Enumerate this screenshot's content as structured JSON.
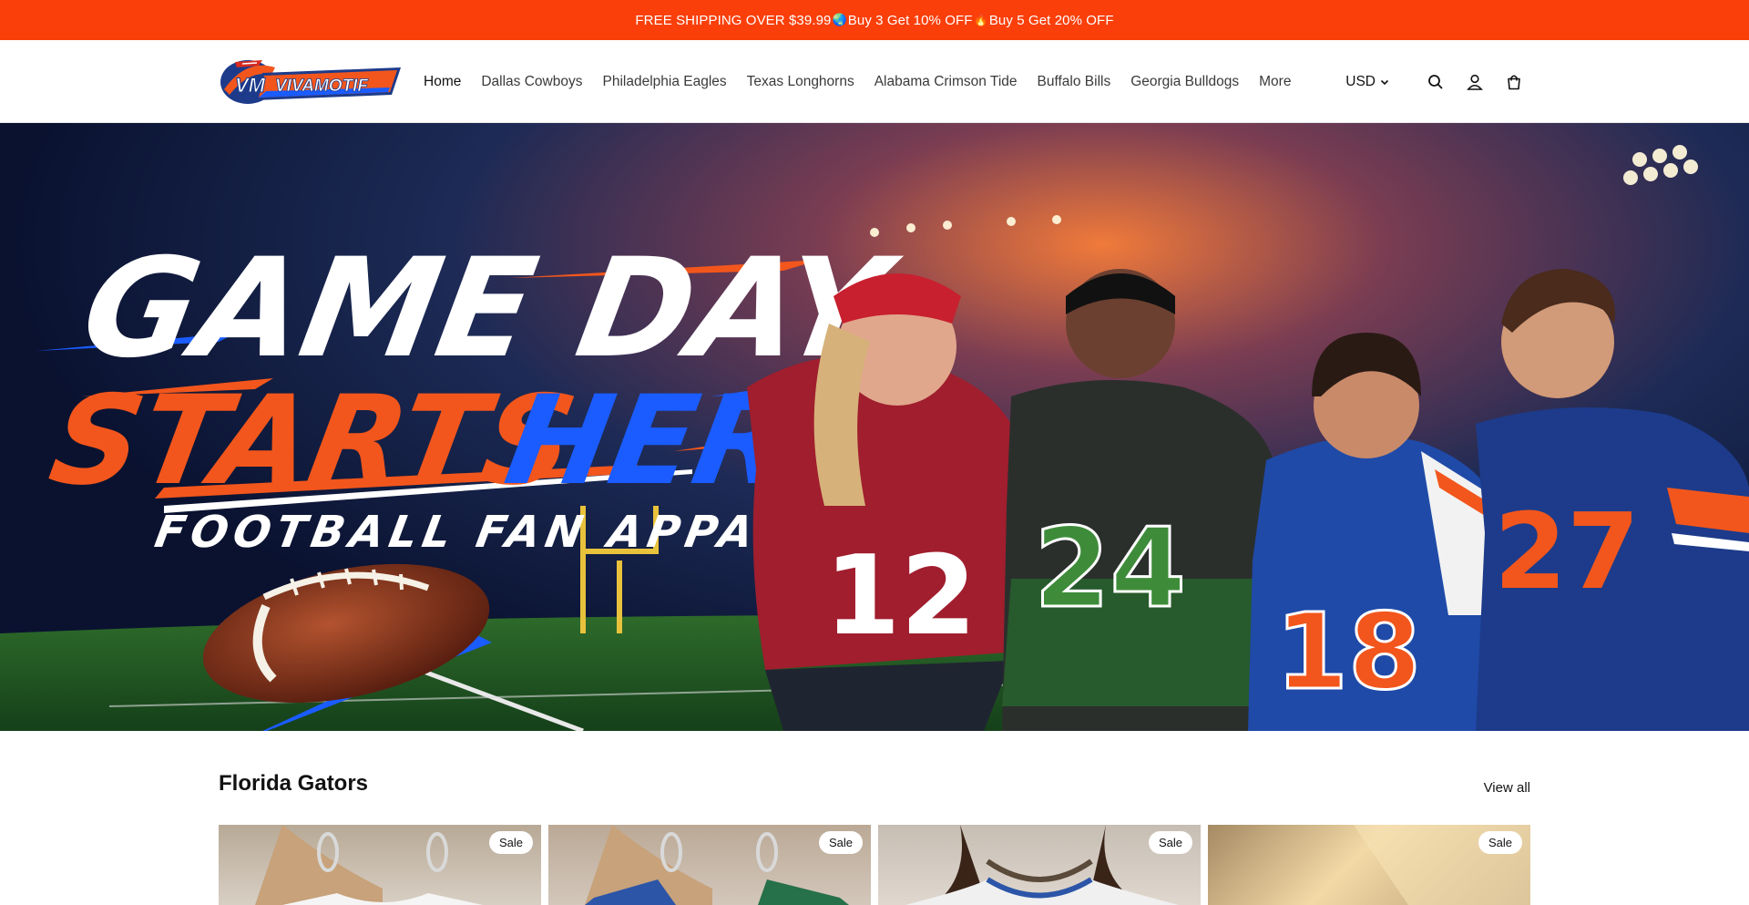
{
  "announcement": {
    "part1": "FREE SHIPPING OVER $39.99",
    "part2": "Buy 3 Get 10% OFF",
    "part3": "Buy 5 Get 20% OFF",
    "emoji1": "🌏",
    "emoji2": "🔥"
  },
  "header": {
    "logo_text": "VIVAMOTIF",
    "logo_monogram": "VM",
    "nav": [
      {
        "label": "Home",
        "active": true
      },
      {
        "label": "Dallas Cowboys"
      },
      {
        "label": "Philadelphia Eagles"
      },
      {
        "label": "Texas Longhorns"
      },
      {
        "label": "Alabama Crimson Tide"
      },
      {
        "label": "Buffalo Bills"
      },
      {
        "label": "Georgia Bulldogs"
      },
      {
        "label": "More"
      }
    ],
    "currency": "USD",
    "icons": [
      "search-icon",
      "account-icon",
      "cart-icon"
    ]
  },
  "hero": {
    "headline_line1": "GAME DAY",
    "headline_word2a": "STARTS",
    "headline_word2b": "HERE",
    "subheadline": "FOOTBALL FAN APPAREL",
    "jersey_numbers": [
      "12",
      "24",
      "18",
      "27"
    ]
  },
  "collection": {
    "title": "Florida Gators",
    "view_all": "View all",
    "products": [
      {
        "badge": "Sale"
      },
      {
        "badge": "Sale"
      },
      {
        "badge": "Sale"
      },
      {
        "badge": "Sale"
      }
    ]
  },
  "colors": {
    "announcement_bg": "#fa3f0a",
    "hero_orange": "#f2561c",
    "hero_blue": "#1a5cff"
  }
}
